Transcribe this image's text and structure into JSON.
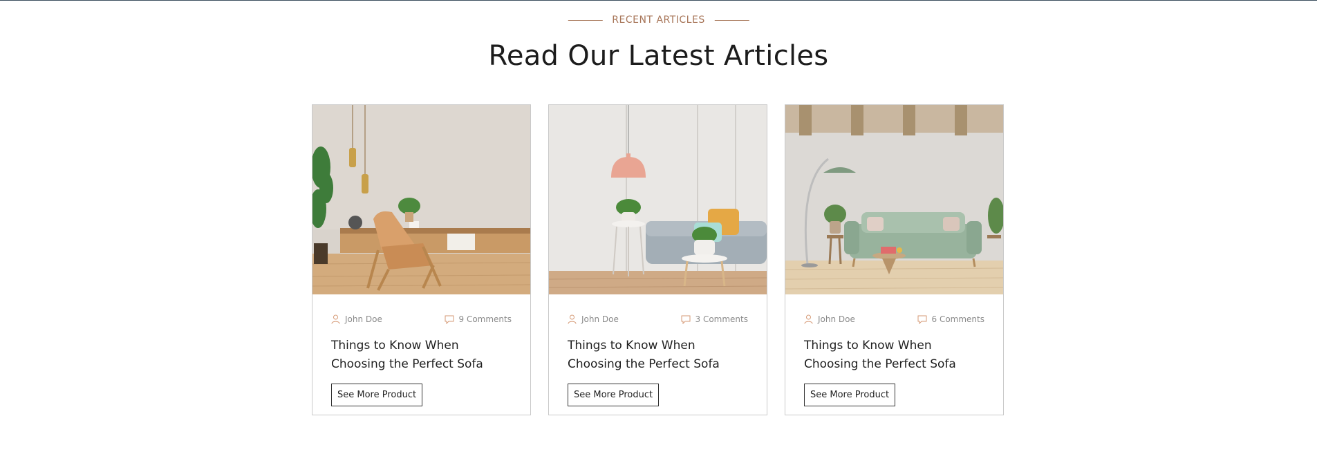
{
  "section": {
    "eyebrow": "RECENT ARTICLES",
    "title": "Read Our Latest Articles"
  },
  "colors": {
    "accent": "#a77558",
    "border": "#c9c9c9",
    "text": "#1f1f1f",
    "meta": "#8a8a8a"
  },
  "icons": {
    "author": "user-icon",
    "comments": "comment-icon"
  },
  "articles": [
    {
      "author": "John Doe",
      "comments": "9 Comments",
      "title": "Things to Know When Choosing the Perfect Sofa",
      "button": "See More Product",
      "image": "living-room-wooden-armchair"
    },
    {
      "author": "John Doe",
      "comments": "3 Comments",
      "title": "Things to Know When Choosing the Perfect Sofa",
      "button": "See More Product",
      "image": "living-room-gray-sofa-pink-lamp"
    },
    {
      "author": "John Doe",
      "comments": "6 Comments",
      "title": "Things to Know When Choosing the Perfect Sofa",
      "button": "See More Product",
      "image": "living-room-green-sofa-floor-lamp"
    }
  ]
}
